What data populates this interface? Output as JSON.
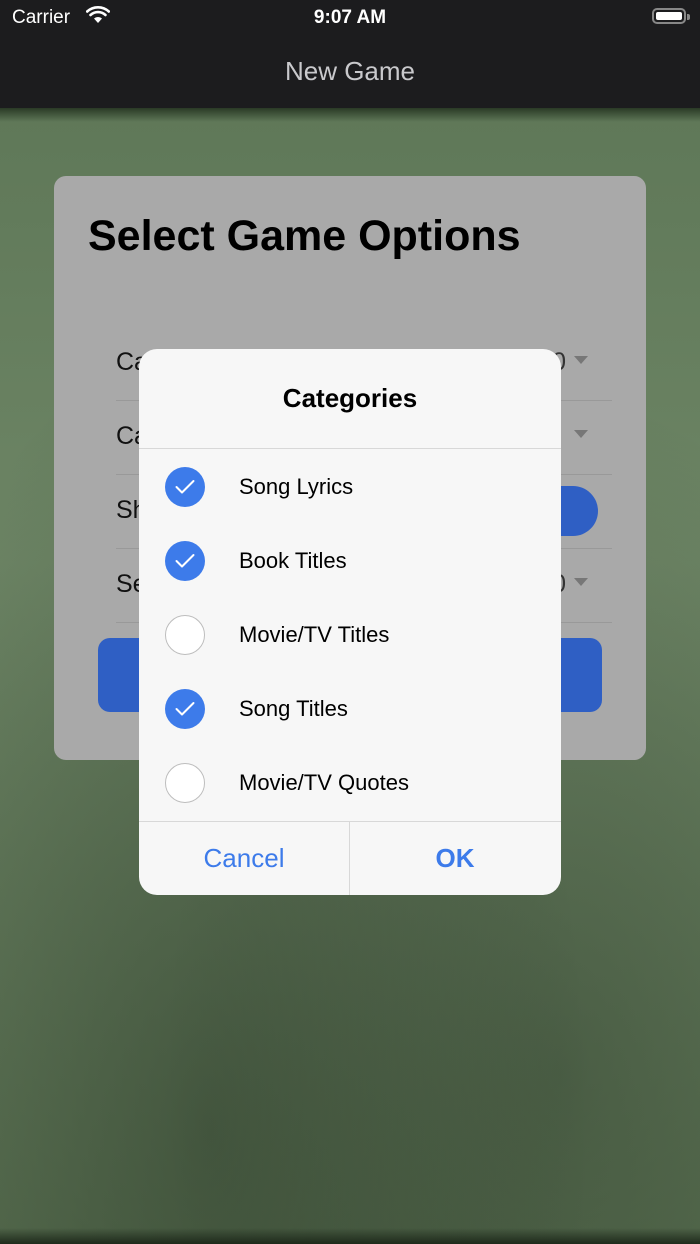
{
  "status_bar": {
    "carrier": "Carrier",
    "time": "9:07 AM"
  },
  "nav": {
    "title": "New Game"
  },
  "panel": {
    "heading": "Select Game Options",
    "rows": [
      {
        "label": "Ca",
        "value": "0"
      },
      {
        "label": "Ca",
        "value": ""
      },
      {
        "label": "Sh",
        "value": ""
      },
      {
        "label": "Se",
        "value": "0"
      }
    ]
  },
  "alert": {
    "title": "Categories",
    "options": [
      {
        "label": "Song Lyrics",
        "checked": true
      },
      {
        "label": "Book Titles",
        "checked": true
      },
      {
        "label": "Movie/TV Titles",
        "checked": false
      },
      {
        "label": "Song Titles",
        "checked": true
      },
      {
        "label": "Movie/TV Quotes",
        "checked": false
      }
    ],
    "cancel_label": "Cancel",
    "ok_label": "OK"
  },
  "colors": {
    "accent": "#3d7bea",
    "background": "#6d8565"
  },
  "icons": {
    "check": "checkmark-icon",
    "wifi": "wifi-icon",
    "battery": "battery-icon"
  }
}
